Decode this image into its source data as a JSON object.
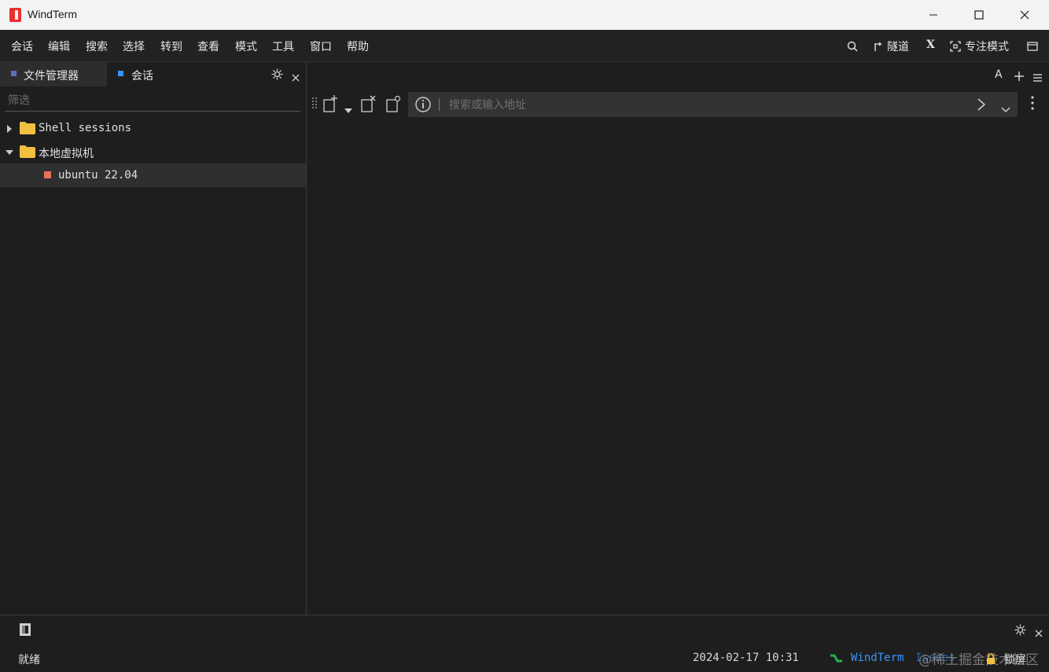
{
  "window": {
    "title": "WindTerm"
  },
  "menu": {
    "items": [
      "会话",
      "编辑",
      "搜索",
      "选择",
      "转到",
      "查看",
      "模式",
      "工具",
      "窗口",
      "帮助"
    ]
  },
  "toolbar_right": {
    "tunnel": "隧道",
    "x_label": "X",
    "focus_mode": "专注模式"
  },
  "sidebar": {
    "tabs": [
      {
        "label": "文件管理器"
      },
      {
        "label": "会话"
      }
    ],
    "filter_placeholder": "筛选",
    "tree": [
      {
        "label": "Shell sessions",
        "expanded": false
      },
      {
        "label": "本地虚拟机",
        "expanded": true,
        "children": [
          {
            "label": "ubuntu 22.04"
          }
        ]
      }
    ]
  },
  "main": {
    "font_button": "A",
    "address_placeholder": "搜索或输入地址"
  },
  "statusbar": {
    "ready": "就绪",
    "datetime": "2024-02-17 10:31",
    "brand": "WindTerm",
    "brand_suffix": "Issues",
    "watermark": "@稀土掘金技术社区",
    "lock": "锁屏"
  },
  "colors": {
    "accent_blue": "#3794ff",
    "session_orange": "#e8735a",
    "folder": "#f0c040",
    "green": "#23b14d"
  }
}
